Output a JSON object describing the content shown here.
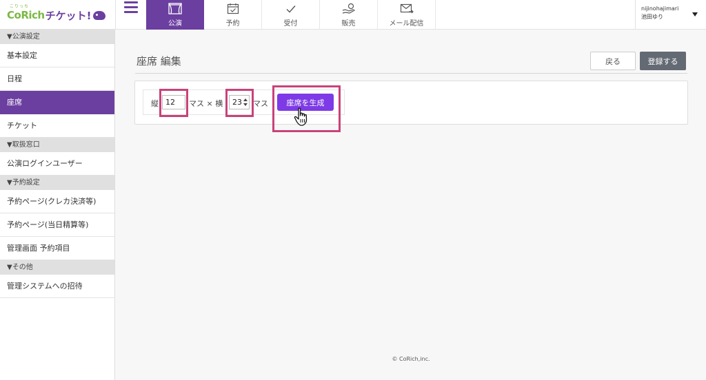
{
  "app": {
    "logo_ruby": "こりっち",
    "logo_main": "CoRich",
    "logo_sub": "チケット!",
    "brand_color": "#6b3fa0",
    "accent_green": "#7bb843"
  },
  "nav": {
    "tabs": [
      {
        "label": "公演",
        "icon": "theater-curtain-icon",
        "active": true
      },
      {
        "label": "予約",
        "icon": "calendar-check-icon",
        "active": false
      },
      {
        "label": "受付",
        "icon": "checkmark-icon",
        "active": false
      },
      {
        "label": "販売",
        "icon": "hand-coin-icon",
        "active": false
      },
      {
        "label": "メール配信",
        "icon": "mail-send-icon",
        "active": false
      }
    ]
  },
  "user": {
    "id": "nijinohajimari",
    "name": "池田ゆり"
  },
  "sidebar": {
    "sections": [
      {
        "title": "▼公演設定",
        "items": [
          {
            "label": "基本設定",
            "active": false
          },
          {
            "label": "日程",
            "active": false
          },
          {
            "label": "座席",
            "active": true
          },
          {
            "label": "チケット",
            "active": false
          }
        ]
      },
      {
        "title": "▼取扱窓口",
        "items": [
          {
            "label": "公演ログインユーザー",
            "active": false
          }
        ]
      },
      {
        "title": "▼予約設定",
        "items": [
          {
            "label": "予約ページ(クレカ決済等)",
            "active": false
          },
          {
            "label": "予約ページ(当日精算等)",
            "active": false
          },
          {
            "label": "管理画面 予約項目",
            "active": false
          }
        ]
      },
      {
        "title": "▼その他",
        "items": [
          {
            "label": "管理システムへの招待",
            "active": false
          }
        ]
      }
    ]
  },
  "main": {
    "title": "座席 編集",
    "back_label": "戻る",
    "register_label": "登録する",
    "form": {
      "rows_label": "縦",
      "rows_value": "12",
      "unit_cross_label": "マス × 横",
      "cols_value": "23",
      "unit_label": "マス",
      "generate_label": "座席を生成"
    }
  },
  "footer": {
    "copyright": "© CoRich,inc."
  }
}
